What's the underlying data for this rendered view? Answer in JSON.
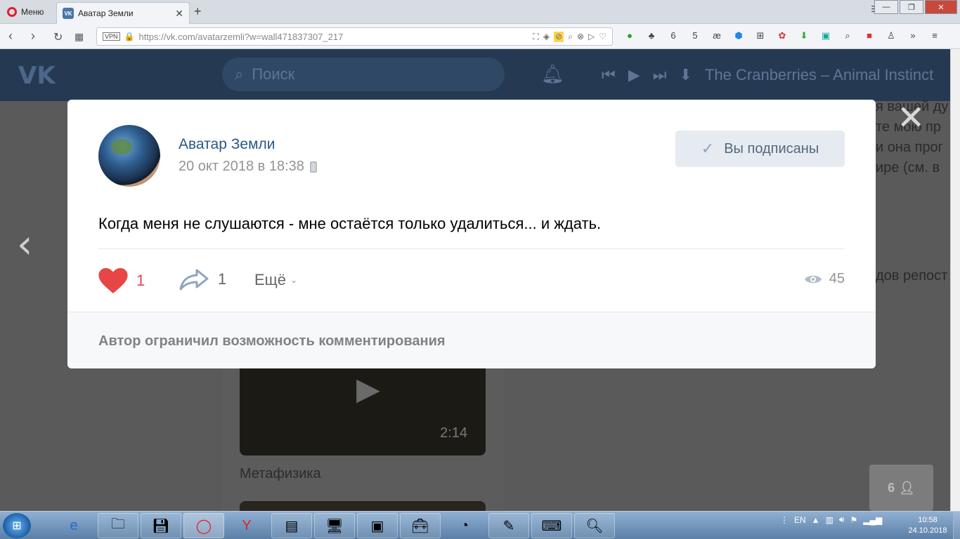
{
  "browser": {
    "menu_label": "Меню",
    "tab_title": "Аватар Земли",
    "tab_favicon": "VK",
    "url": "https://vk.com/avatarzemli?w=wall471837307_217",
    "vpn_label": "VPN",
    "ext_badge_1": "6",
    "ext_badge_2": "5",
    "ext_ae": "æ"
  },
  "vk": {
    "logo": "VK",
    "search_placeholder": "Поиск",
    "now_playing": "The Cranberries – Animal Instinct"
  },
  "background": {
    "side_text_lines": [
      "я вашей ду",
      "те мою пр",
      "и она прог",
      "ире (см. в"
    ],
    "repost_text": "дов репост",
    "video_duration": "2:14",
    "video_title": "Метафизика",
    "online_count": "6"
  },
  "post": {
    "author": "Аватар Земли",
    "date": "20 окт 2018 в 18:38",
    "subscribe_label": "Вы подписаны",
    "text": "Когда меня не слушаются - мне остаётся только удалиться... и ждать.",
    "likes": "1",
    "shares": "1",
    "more_label": "Ещё",
    "views": "45",
    "comments_note": "Автор ограничил возможность комментирования"
  },
  "taskbar": {
    "language": "EN",
    "time": "10:58",
    "date": "24.10.2018"
  },
  "colors": {
    "vk_blue": "#2a5885",
    "like_red": "#e64646",
    "header_dark": "#253a52"
  }
}
